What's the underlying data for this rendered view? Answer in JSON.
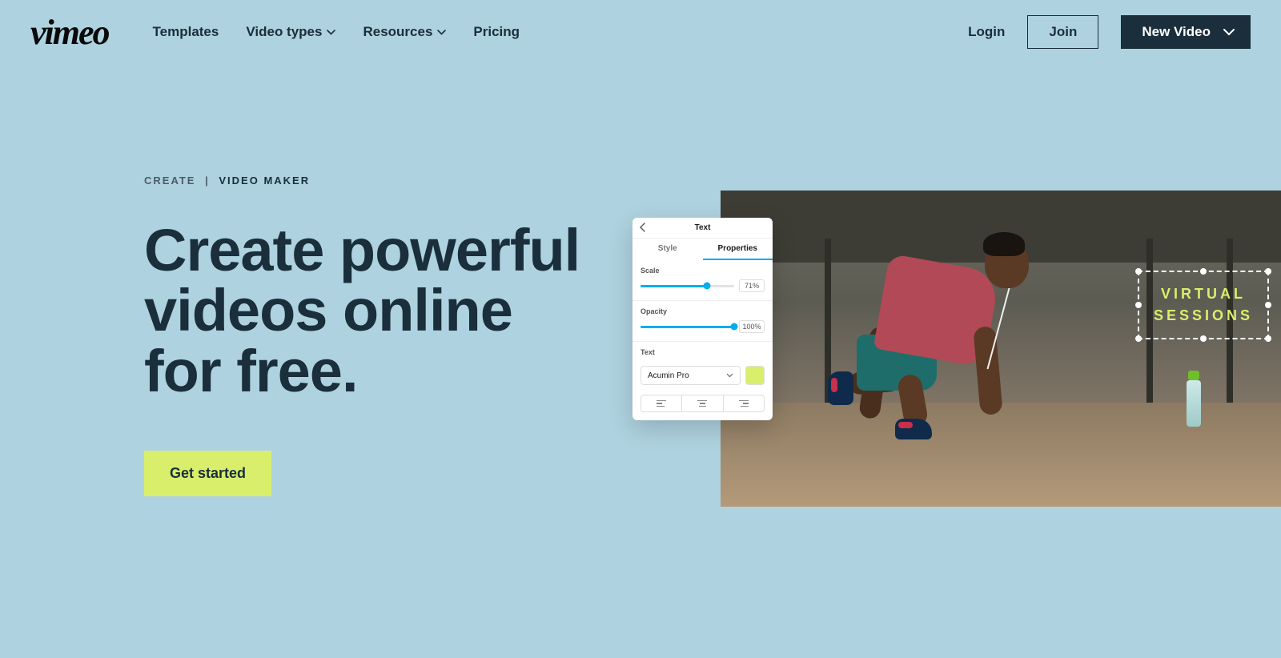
{
  "brand": "vimeo",
  "nav": {
    "templates": "Templates",
    "videoTypes": "Video types",
    "resources": "Resources",
    "pricing": "Pricing"
  },
  "auth": {
    "login": "Login",
    "join": "Join",
    "newVideo": "New Video"
  },
  "breadcrumb": {
    "root": "CREATE",
    "sep": "|",
    "current": "VIDEO MAKER"
  },
  "hero": {
    "title": "Create powerful videos online for free.",
    "cta": "Get started"
  },
  "overlay": {
    "line1": "VIRTUAL",
    "line2": "SESSIONS"
  },
  "panel": {
    "title": "Text",
    "tabs": {
      "style": "Style",
      "properties": "Properties"
    },
    "scale": {
      "label": "Scale",
      "value": "71%",
      "pct": 71
    },
    "opacity": {
      "label": "Opacity",
      "value": "100%",
      "pct": 100
    },
    "textLabel": "Text",
    "font": "Acumin Pro",
    "swatchColor": "#d9ef6c"
  }
}
